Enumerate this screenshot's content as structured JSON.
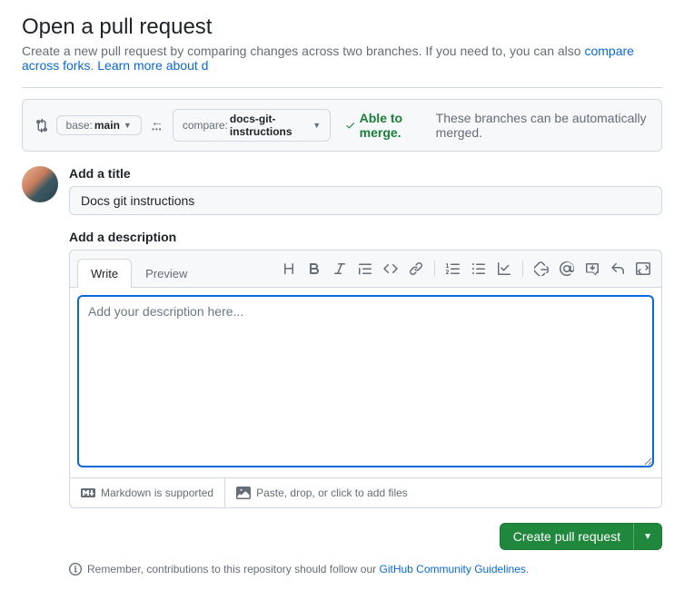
{
  "header": {
    "title": "Open a pull request",
    "subtitle_pre": "Create a new pull request by comparing changes across two branches. If you need to, you can also ",
    "link_compare": "compare across forks",
    "subtitle_mid": ". ",
    "link_learn": "Learn more about d"
  },
  "compare": {
    "base_label": "base: ",
    "base_branch": "main",
    "compare_label": "compare: ",
    "compare_branch": "docs-git-instructions",
    "merge_ok": "Able to merge.",
    "merge_msg": " These branches can be automatically merged."
  },
  "form": {
    "title_label": "Add a title",
    "title_value": "Docs git instructions",
    "desc_label": "Add a description",
    "tab_write": "Write",
    "tab_preview": "Preview",
    "desc_placeholder": "Add your description here...",
    "markdown_hint": "Markdown is supported",
    "paste_hint": "Paste, drop, or click to add files",
    "submit_label": "Create pull request"
  },
  "footer": {
    "contrib_pre": "Remember, contributions to this repository should follow our ",
    "contrib_link": "GitHub Community Guidelines",
    "contrib_post": "."
  }
}
